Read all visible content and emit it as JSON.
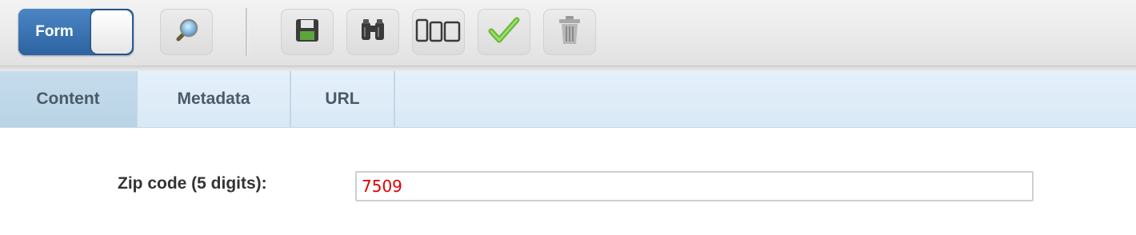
{
  "toolbar": {
    "form_toggle_label": "Form",
    "buttons": [
      {
        "name": "preview",
        "icon": "magnifier-icon"
      },
      {
        "name": "save",
        "icon": "floppy-disk-icon"
      },
      {
        "name": "find",
        "icon": "binoculars-icon"
      },
      {
        "name": "devices",
        "icon": "devices-icon"
      },
      {
        "name": "validate",
        "icon": "checkmark-icon"
      },
      {
        "name": "delete",
        "icon": "trash-icon"
      }
    ]
  },
  "tabs": [
    {
      "label": "Content",
      "active": true
    },
    {
      "label": "Metadata",
      "active": false
    },
    {
      "label": "URL",
      "active": false
    }
  ],
  "form": {
    "zip_label": "Zip code (5 digits):",
    "zip_value": "7509"
  },
  "colors": {
    "toggle_blue": "#2f6aa8",
    "tab_active": "#bcd5e8",
    "tab_bar": "#deedf8",
    "invalid_text": "#e00000"
  }
}
